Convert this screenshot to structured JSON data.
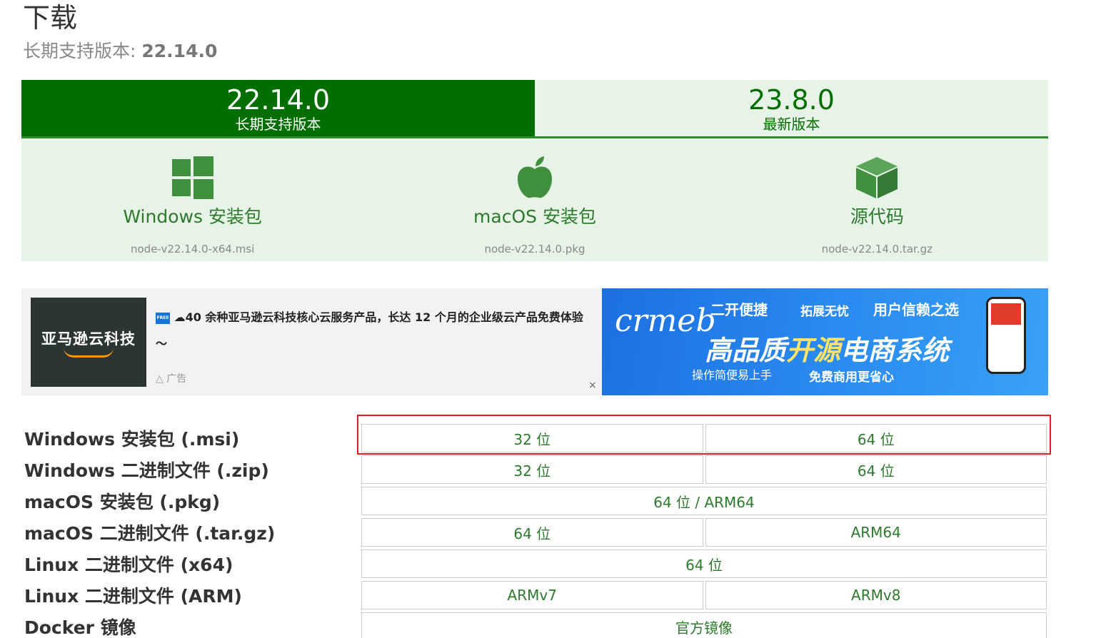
{
  "header": {
    "title": "下载",
    "lts_prefix": "长期支持版本:",
    "lts_version": "22.14.0"
  },
  "tabs": [
    {
      "version": "22.14.0",
      "label": "长期支持版本",
      "active": true
    },
    {
      "version": "23.8.0",
      "label": "最新版本",
      "active": false
    }
  ],
  "downloads": [
    {
      "label": "Windows 安装包",
      "file": "node-v22.14.0-x64.msi",
      "icon": "windows-icon"
    },
    {
      "label": "macOS 安装包",
      "file": "node-v22.14.0.pkg",
      "icon": "apple-icon"
    },
    {
      "label": "源代码",
      "file": "node-v22.14.0.tar.gz",
      "icon": "box-icon"
    }
  ],
  "ad": {
    "thumb_text": "亚马逊云科技",
    "free_badge": "FREE",
    "text": "☁40 余种亚马逊云科技核心云服务产品，长达 12 个月的企业级云产品免费体验～",
    "tag": "广告",
    "close": "×"
  },
  "banner": {
    "logo": "crmeb",
    "chip1": "二开便捷",
    "chip2": "拓展无忧",
    "chip3": "用户信赖之选",
    "headline_a": "高品质",
    "headline_b": "开源",
    "headline_c": "电商系统",
    "chip4": "操作简便易上手",
    "chip5": "免费商用更省心"
  },
  "platforms": [
    {
      "label": "Windows 安装包 (.msi)",
      "cells": [
        "32 位",
        "64 位"
      ]
    },
    {
      "label": "Windows 二进制文件 (.zip)",
      "cells": [
        "32 位",
        "64 位"
      ]
    },
    {
      "label": "macOS 安装包 (.pkg)",
      "cells": [
        "64 位 / ARM64"
      ]
    },
    {
      "label": "macOS 二进制文件 (.tar.gz)",
      "cells": [
        "64 位",
        "ARM64"
      ]
    },
    {
      "label": "Linux 二进制文件 (x64)",
      "cells": [
        "64 位"
      ]
    },
    {
      "label": "Linux 二进制文件 (ARM)",
      "cells": [
        "ARMv7",
        "ARMv8"
      ]
    },
    {
      "label": "Docker 镜像",
      "cells": [
        "官方镜像"
      ]
    }
  ],
  "colors": {
    "brand_green": "#026e00",
    "light_green": "#e6f3e6",
    "link_green": "#2c7a2c",
    "highlight_red": "#e51c23"
  }
}
